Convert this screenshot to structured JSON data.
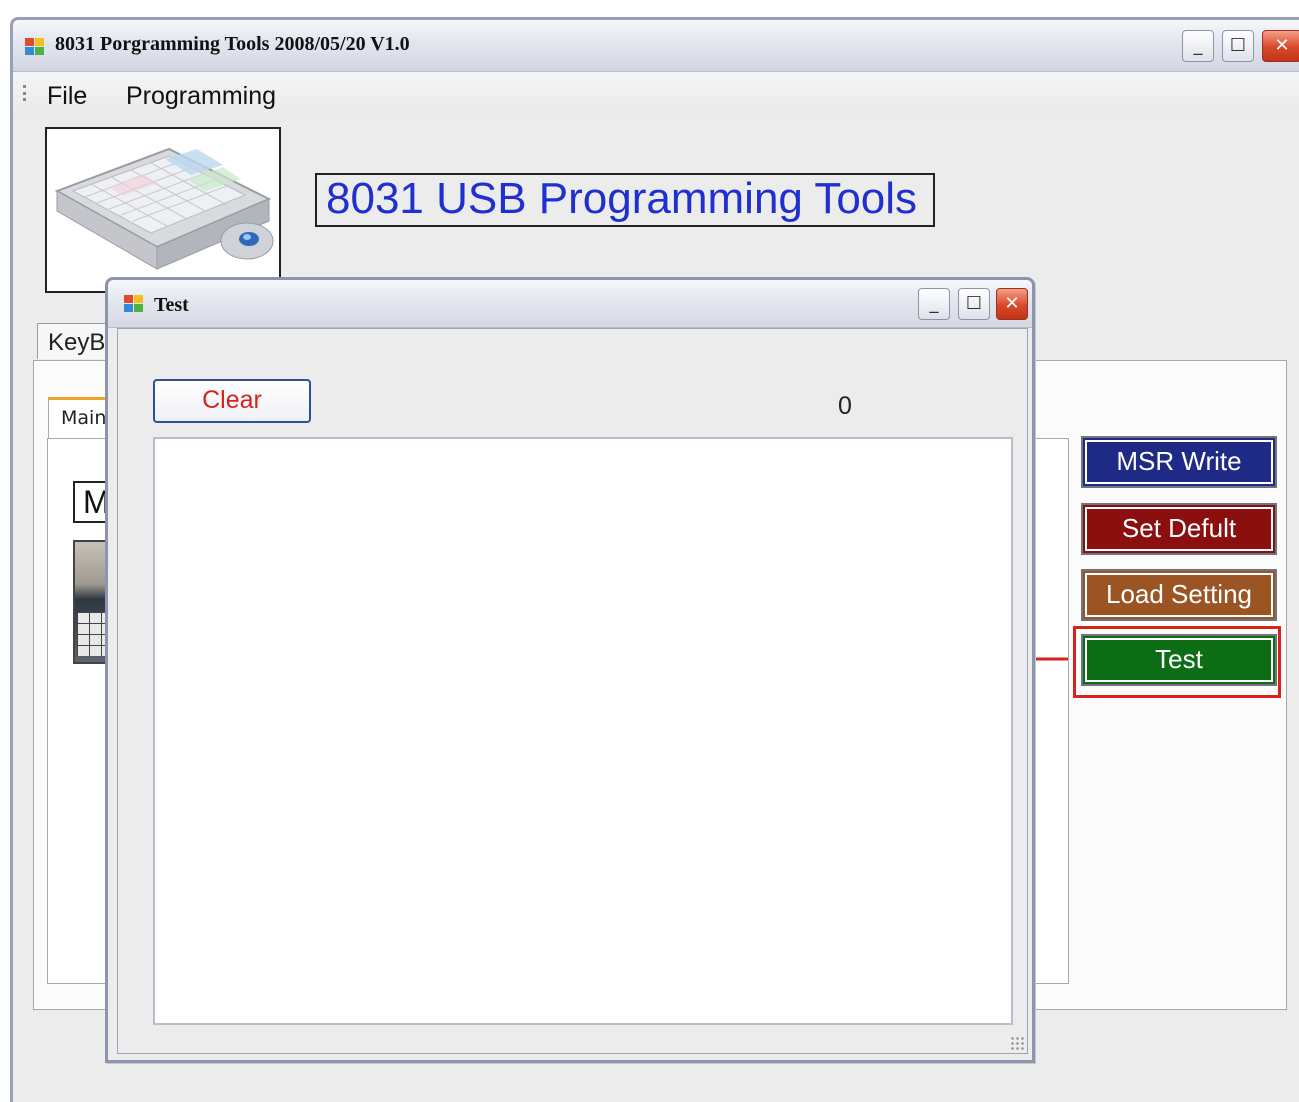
{
  "main_window": {
    "title": "8031 Porgramming Tools 2008/05/20 V1.0",
    "controls": {
      "minimize": "_",
      "maximize": "☐",
      "close": "✕"
    }
  },
  "menu": {
    "items": [
      {
        "label": "File"
      },
      {
        "label": "Programming"
      }
    ]
  },
  "header": {
    "heading": "8031 USB Programming Tools"
  },
  "tabs": {
    "outer_tab_label": "KeyBo",
    "inner_tab_label": "Main S",
    "ma_box_text": "Ma"
  },
  "side_buttons": {
    "msr_write": "MSR Write",
    "set_default": "Set Defult",
    "load_setting": "Load Setting",
    "test": "Test"
  },
  "test_dialog": {
    "title": "Test",
    "controls": {
      "minimize": "_",
      "maximize": "☐",
      "close": "✕"
    },
    "clear_label": "Clear",
    "counter": "0",
    "output_text": ""
  },
  "colors": {
    "heading": "#1f2fd0",
    "msr_write": "#1f2a86",
    "set_default": "#8b0f0f",
    "load_setting": "#9b5423",
    "test": "#0d6d14",
    "clear_text": "#d9221b",
    "highlight": "#d8221b"
  },
  "icons": [
    "app-icon",
    "minimize-icon",
    "maximize-icon",
    "close-icon",
    "keyboard-device-image",
    "arrow-left-icon"
  ]
}
